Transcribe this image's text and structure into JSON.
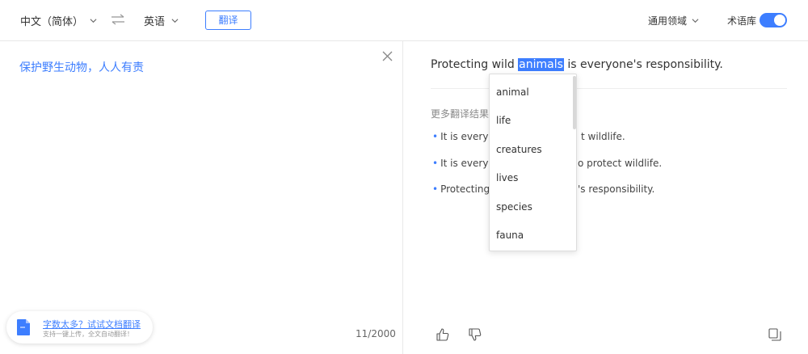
{
  "toolbar": {
    "source_lang": "中文（简体）",
    "target_lang": "英语",
    "translate_label": "翻译",
    "domain_label": "通用领域",
    "glossary_label": "术语库",
    "glossary_enabled": true
  },
  "source": {
    "text": "保护野生动物，人人有责",
    "char_count": "11/2000"
  },
  "doc_promo": {
    "title": "字数太多？试试文档翻译",
    "subtitle": "支持一键上传，全文自动翻译！"
  },
  "result": {
    "before": "Protecting wild ",
    "highlight": "animals",
    "after": " is everyone's responsibility."
  },
  "more_results": {
    "label": "更多翻译结果",
    "items": [
      "It is everyo",
      "It is everyo",
      "Protecting"
    ],
    "items_tail": [
      "t wildlife.",
      "o protect wildlife.",
      "'s responsibility."
    ]
  },
  "dropdown": {
    "options": [
      "animal",
      "life",
      "creatures",
      "lives",
      "species",
      "fauna"
    ]
  },
  "colors": {
    "accent": "#3d7eff",
    "divider": "#e8e8e8"
  }
}
